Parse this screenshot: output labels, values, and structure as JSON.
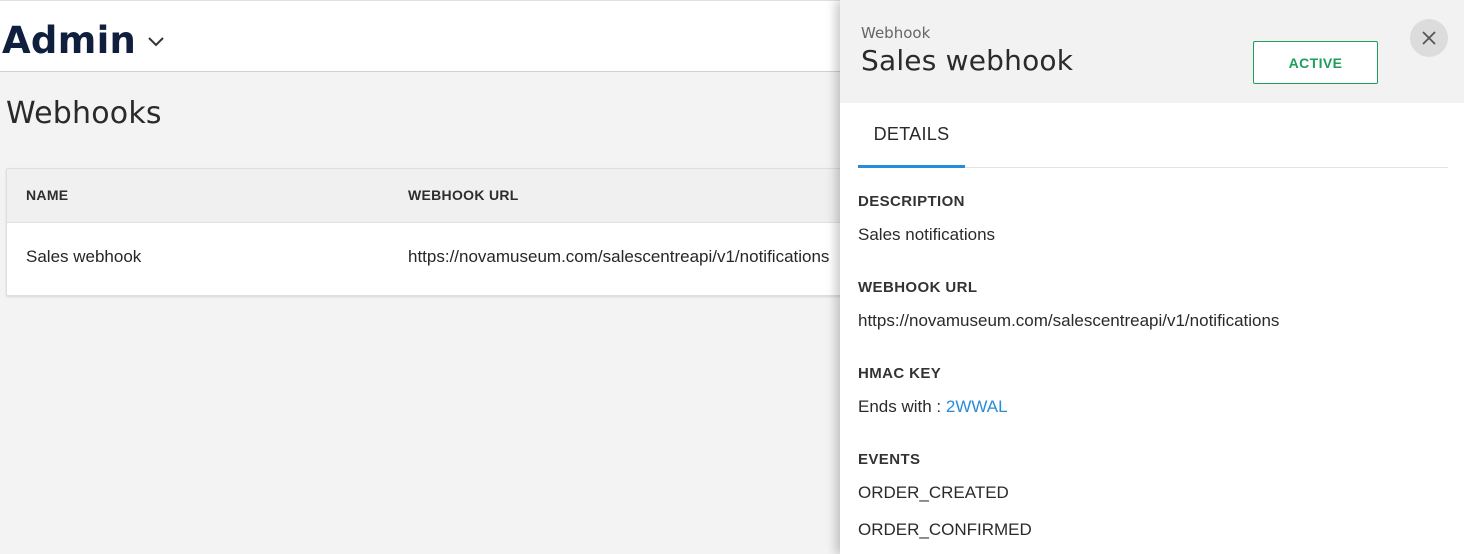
{
  "header": {
    "app_title": "Admin",
    "app_menu_icon": "chevron-down-icon"
  },
  "page": {
    "title": "Webhooks"
  },
  "table": {
    "columns": [
      "NAME",
      "WEBHOOK URL"
    ],
    "rows": [
      {
        "name": "Sales webhook",
        "url": "https://novamuseum.com/salescentreapi/v1/notifications"
      }
    ]
  },
  "panel": {
    "kicker": "Webhook",
    "title": "Sales webhook",
    "status_label": "ACTIVE",
    "close_icon": "close-icon",
    "tabs": [
      "DETAILS"
    ],
    "fields": {
      "description": {
        "label": "DESCRIPTION",
        "value": "Sales notifications"
      },
      "webhook_url": {
        "label": "WEBHOOK URL",
        "value": "https://novamuseum.com/salescentreapi/v1/notifications"
      },
      "hmac_key": {
        "label": "HMAC KEY",
        "prefix": "Ends with : ",
        "suffix": "2WWAL"
      },
      "events": {
        "label": "EVENTS",
        "values": [
          "ORDER_CREATED",
          "ORDER_CONFIRMED"
        ]
      }
    }
  },
  "colors": {
    "accent": "#2a8bd6",
    "status_active": "#1e9e5a",
    "title_navy": "#0f1f3d"
  }
}
